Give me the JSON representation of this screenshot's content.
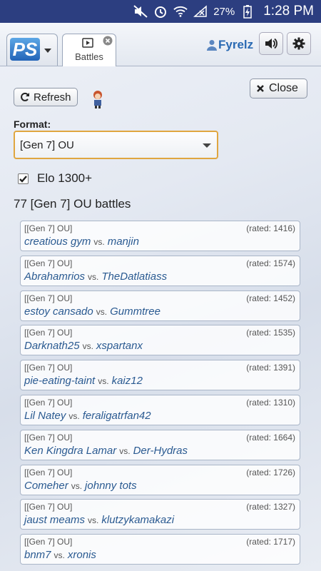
{
  "status_bar": {
    "battery": "27%",
    "time": "1:28 PM"
  },
  "header": {
    "logo": "PS",
    "tabs": [
      {
        "label": "Battles"
      }
    ],
    "username": "Fyrelz"
  },
  "controls": {
    "refresh_label": "Refresh",
    "close_label": "Close",
    "format_label": "Format:",
    "format_value": "[Gen 7] OU",
    "elo_checked": true,
    "elo_label": "Elo 1300+"
  },
  "count_text": "77 [Gen 7] OU battles",
  "vs_label": "vs.",
  "battles": [
    {
      "format": "[[Gen 7] OU]",
      "rating": "(rated: 1416)",
      "p1": "creatious gym",
      "p2": "manjin"
    },
    {
      "format": "[[Gen 7] OU]",
      "rating": "(rated: 1574)",
      "p1": "Abrahamrios",
      "p2": "TheDatlatiass"
    },
    {
      "format": "[[Gen 7] OU]",
      "rating": "(rated: 1452)",
      "p1": "estoy cansado",
      "p2": "Gummtree"
    },
    {
      "format": "[[Gen 7] OU]",
      "rating": "(rated: 1535)",
      "p1": "Darknath25",
      "p2": "xspartanx"
    },
    {
      "format": "[[Gen 7] OU]",
      "rating": "(rated: 1391)",
      "p1": "pie-eating-taint",
      "p2": "kaiz12"
    },
    {
      "format": "[[Gen 7] OU]",
      "rating": "(rated: 1310)",
      "p1": "Lil Natey",
      "p2": "feraligatrfan42"
    },
    {
      "format": "[[Gen 7] OU]",
      "rating": "(rated: 1664)",
      "p1": "Ken Kingdra Lamar",
      "p2": "Der-Hydras"
    },
    {
      "format": "[[Gen 7] OU]",
      "rating": "(rated: 1726)",
      "p1": "Comeher",
      "p2": "johnny tots"
    },
    {
      "format": "[[Gen 7] OU]",
      "rating": "(rated: 1327)",
      "p1": "jaust meams",
      "p2": "klutzykamakazi"
    },
    {
      "format": "[[Gen 7] OU]",
      "rating": "(rated: 1717)",
      "p1": "bnm7",
      "p2": "xronis"
    }
  ]
}
